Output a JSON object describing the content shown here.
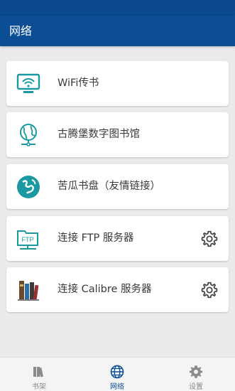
{
  "appbar": {
    "title": "网络"
  },
  "items": [
    {
      "label": "WiFi传书",
      "icon": "wifi-monitor-icon",
      "has_settings": false
    },
    {
      "label": "古腾堡数字图书馆",
      "icon": "globe-network-icon",
      "has_settings": false
    },
    {
      "label": "苦瓜书盘（友情链接）",
      "icon": "earth-logo-icon",
      "has_settings": false
    },
    {
      "label": "连接 FTP 服务器",
      "icon": "ftp-folder-icon",
      "has_settings": true
    },
    {
      "label": "连接 Calibre 服务器",
      "icon": "calibre-books-icon",
      "has_settings": true
    }
  ],
  "tabs": [
    {
      "label": "书架",
      "icon": "bookshelf-icon",
      "active": false
    },
    {
      "label": "网络",
      "icon": "globe-icon",
      "active": true
    },
    {
      "label": "设置",
      "icon": "gear-icon",
      "active": false
    }
  ],
  "colors": {
    "primary": "#0c4e96",
    "teal": "#1a9aa0",
    "background": "#ebebeb",
    "inactive_tab": "#8a8a8a"
  }
}
